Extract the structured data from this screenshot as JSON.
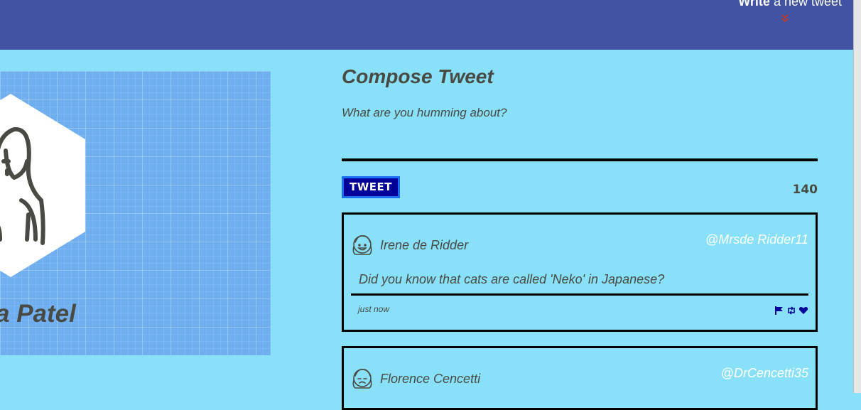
{
  "nav": {
    "write_bold": "Write",
    "write_rest": " a new tweet",
    "chevron_icon": "double-chevron-down-icon"
  },
  "profile": {
    "name_visible": "a Patel",
    "avatar_icon": "woman-avatar-icon"
  },
  "compose": {
    "title": "Compose Tweet",
    "prompt": "What are you humming about?",
    "tweet_label": "TWEET",
    "char_count": "140"
  },
  "tweets": [
    {
      "name": "Irene de Ridder",
      "handle": "@Mrsde Ridder11",
      "text": "Did you know that cats are called 'Neko' in Japanese?",
      "time": "just now",
      "icons": [
        "flag-icon",
        "retweet-icon",
        "heart-icon"
      ]
    },
    {
      "name": "Florence Cencetti",
      "handle": "@DrCencetti35"
    }
  ],
  "colors": {
    "nav": "#4153a2",
    "page": "#88e1f8",
    "button": "#000099",
    "accent": "#1a6ef5",
    "icon_blue": "#000099",
    "chevron": "#c0392b"
  }
}
